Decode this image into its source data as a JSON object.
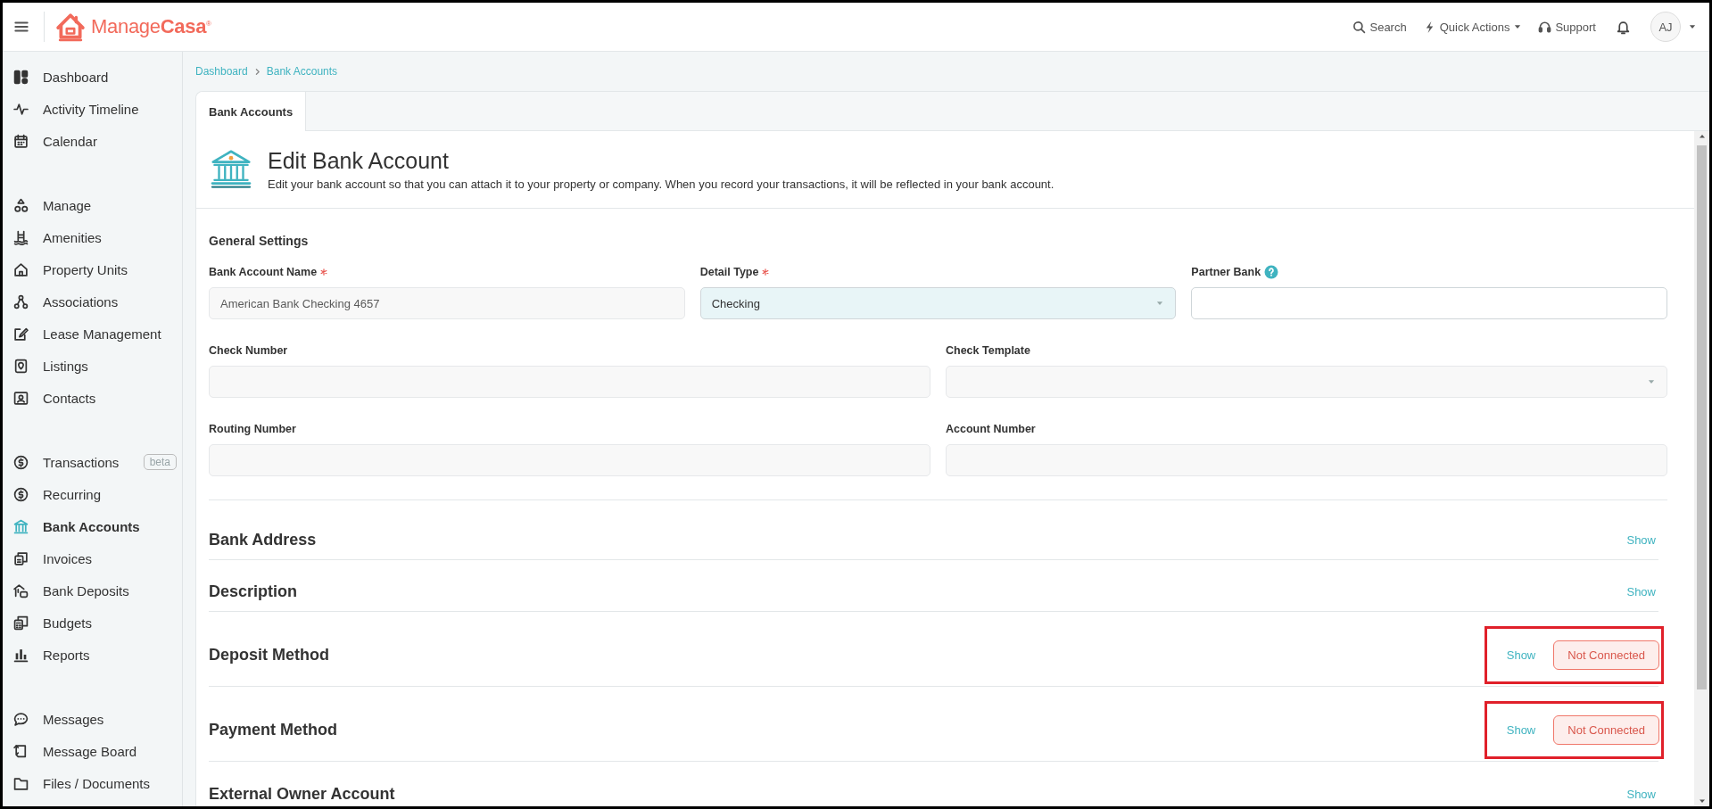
{
  "topbar": {
    "logo": {
      "light": "Manage",
      "bold": "Casa",
      "mark": "®"
    },
    "actions": [
      {
        "kind": "search",
        "label": "Search"
      },
      {
        "kind": "quick",
        "label": "Quick Actions"
      },
      {
        "kind": "support",
        "label": "Support"
      }
    ],
    "avatar": "AJ"
  },
  "sidebar": {
    "groups": [
      [
        {
          "label": "Dashboard",
          "selected": false
        },
        {
          "label": "Activity Timeline",
          "selected": false
        },
        {
          "label": "Calendar",
          "selected": false
        }
      ],
      [
        {
          "label": "Manage",
          "selected": false
        },
        {
          "label": "Amenities",
          "selected": false
        },
        {
          "label": "Property Units",
          "selected": false
        },
        {
          "label": "Associations",
          "selected": false
        },
        {
          "label": "Lease Management",
          "selected": false
        },
        {
          "label": "Listings",
          "selected": false
        },
        {
          "label": "Contacts",
          "selected": false
        }
      ],
      [
        {
          "label": "Transactions",
          "selected": false,
          "badge": "beta"
        },
        {
          "label": "Recurring",
          "selected": false
        },
        {
          "label": "Bank Accounts",
          "selected": true
        },
        {
          "label": "Invoices",
          "selected": false
        },
        {
          "label": "Bank Deposits",
          "selected": false
        },
        {
          "label": "Budgets",
          "selected": false
        },
        {
          "label": "Reports",
          "selected": false
        }
      ],
      [
        {
          "label": "Messages",
          "selected": false
        },
        {
          "label": "Message Board",
          "selected": false
        },
        {
          "label": "Files / Documents",
          "selected": false
        }
      ]
    ]
  },
  "breadcrumb": [
    "Dashboard",
    "Bank Accounts"
  ],
  "tabs": [
    {
      "label": "Bank Accounts",
      "selected": true
    }
  ],
  "page": {
    "title": "Edit Bank Account",
    "description": "Edit your bank account so that you can attach it to your property or company. When you record your transactions, it will be reflected in your bank account."
  },
  "general_settings": {
    "title": "General Settings",
    "rows": [
      [
        {
          "label": "Bank Account Name",
          "required": true,
          "kind": "text",
          "disabled": true,
          "focused": false,
          "value": "American Bank Checking 4657"
        },
        {
          "label": "Detail Type",
          "required": true,
          "kind": "select",
          "disabled": false,
          "focused": true,
          "value": "Checking"
        },
        {
          "label": "Partner Bank",
          "required": false,
          "help": true,
          "kind": "text",
          "disabled": false,
          "focused": false
        }
      ],
      [
        {
          "label": "Check Number",
          "required": false,
          "kind": "text",
          "disabled": true,
          "focused": false
        },
        {
          "label": "Check Template",
          "required": false,
          "kind": "select",
          "disabled": true,
          "focused": false
        }
      ],
      [
        {
          "label": "Routing Number",
          "required": false,
          "kind": "text",
          "disabled": true,
          "focused": false
        },
        {
          "label": "Account Number",
          "required": false,
          "kind": "text",
          "disabled": true,
          "focused": false
        }
      ]
    ]
  },
  "sections": [
    {
      "title": "Bank Address",
      "action": "Show",
      "highlighted": false
    },
    {
      "title": "Description",
      "action": "Show",
      "highlighted": false
    },
    {
      "title": "Deposit Method",
      "action": "Show",
      "status": "Not Connected",
      "highlighted": true
    },
    {
      "title": "Payment Method",
      "action": "Show",
      "status": "Not Connected",
      "highlighted": true
    },
    {
      "title": "External Owner Account",
      "action": "Show",
      "highlighted": false
    }
  ]
}
